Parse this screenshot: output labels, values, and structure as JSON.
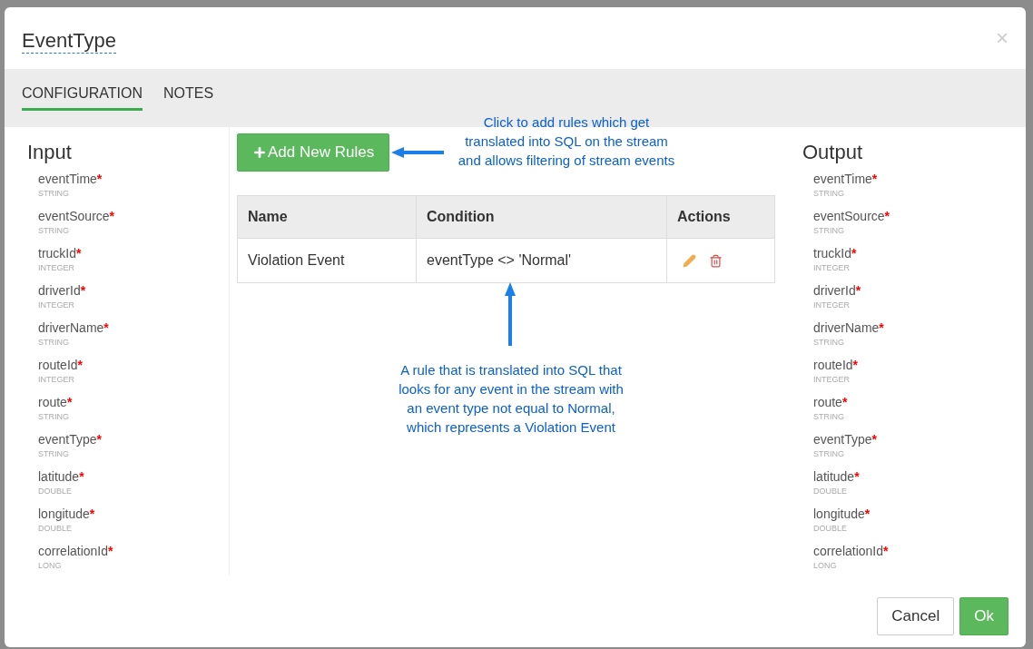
{
  "dialog": {
    "title": "EventType",
    "close": "×"
  },
  "tabs": [
    {
      "label": "CONFIGURATION",
      "selected": true
    },
    {
      "label": "NOTES",
      "selected": false
    }
  ],
  "input": {
    "title": "Input",
    "fields": [
      {
        "name": "eventTime",
        "mark": "*",
        "type": "STRING"
      },
      {
        "name": "eventSource",
        "mark": "*",
        "type": "STRING"
      },
      {
        "name": "truckId",
        "mark": "*",
        "type": "INTEGER"
      },
      {
        "name": "driverId",
        "mark": "*",
        "type": "INTEGER"
      },
      {
        "name": "driverName",
        "mark": "*",
        "type": "STRING"
      },
      {
        "name": "routeId",
        "mark": "*",
        "type": "INTEGER"
      },
      {
        "name": "route",
        "mark": "*",
        "type": "STRING"
      },
      {
        "name": "eventType",
        "mark": "*",
        "type": "STRING"
      },
      {
        "name": "latitude",
        "mark": "*",
        "type": "DOUBLE"
      },
      {
        "name": "longitude",
        "mark": "*",
        "type": "DOUBLE"
      },
      {
        "name": "correlationId",
        "mark": "*",
        "type": "LONG"
      }
    ]
  },
  "rules": {
    "add_button": "Add New Rules",
    "columns": [
      "Name",
      "Condition",
      "Actions"
    ],
    "rows": [
      {
        "name": "Violation Event",
        "condition": "eventType <> 'Normal'"
      }
    ]
  },
  "annotations": [
    "Click to add rules which get translated into SQL on the stream and allows filtering of stream events",
    "A rule that is translated into SQL that looks for any event in the stream with an event type not equal to Normal, which represents a Violation Event"
  ],
  "output": {
    "title": "Output",
    "fields": [
      {
        "name": "eventTime",
        "mark": "*",
        "type": "STRING"
      },
      {
        "name": "eventSource",
        "mark": "*",
        "type": "STRING"
      },
      {
        "name": "truckId",
        "mark": "*",
        "type": "INTEGER"
      },
      {
        "name": "driverId",
        "mark": "*",
        "type": "INTEGER"
      },
      {
        "name": "driverName",
        "mark": "*",
        "type": "STRING"
      },
      {
        "name": "routeId",
        "mark": "*",
        "type": "INTEGER"
      },
      {
        "name": "route",
        "mark": "*",
        "type": "STRING"
      },
      {
        "name": "eventType",
        "mark": "*",
        "type": "STRING"
      },
      {
        "name": "latitude",
        "mark": "*",
        "type": "DOUBLE"
      },
      {
        "name": "longitude",
        "mark": "*",
        "type": "DOUBLE"
      },
      {
        "name": "correlationId",
        "mark": "*",
        "type": "LONG"
      }
    ]
  },
  "buttons": [
    {
      "label": "Cancel",
      "kind": "secondary"
    },
    {
      "label": "Ok",
      "kind": "primary"
    }
  ]
}
